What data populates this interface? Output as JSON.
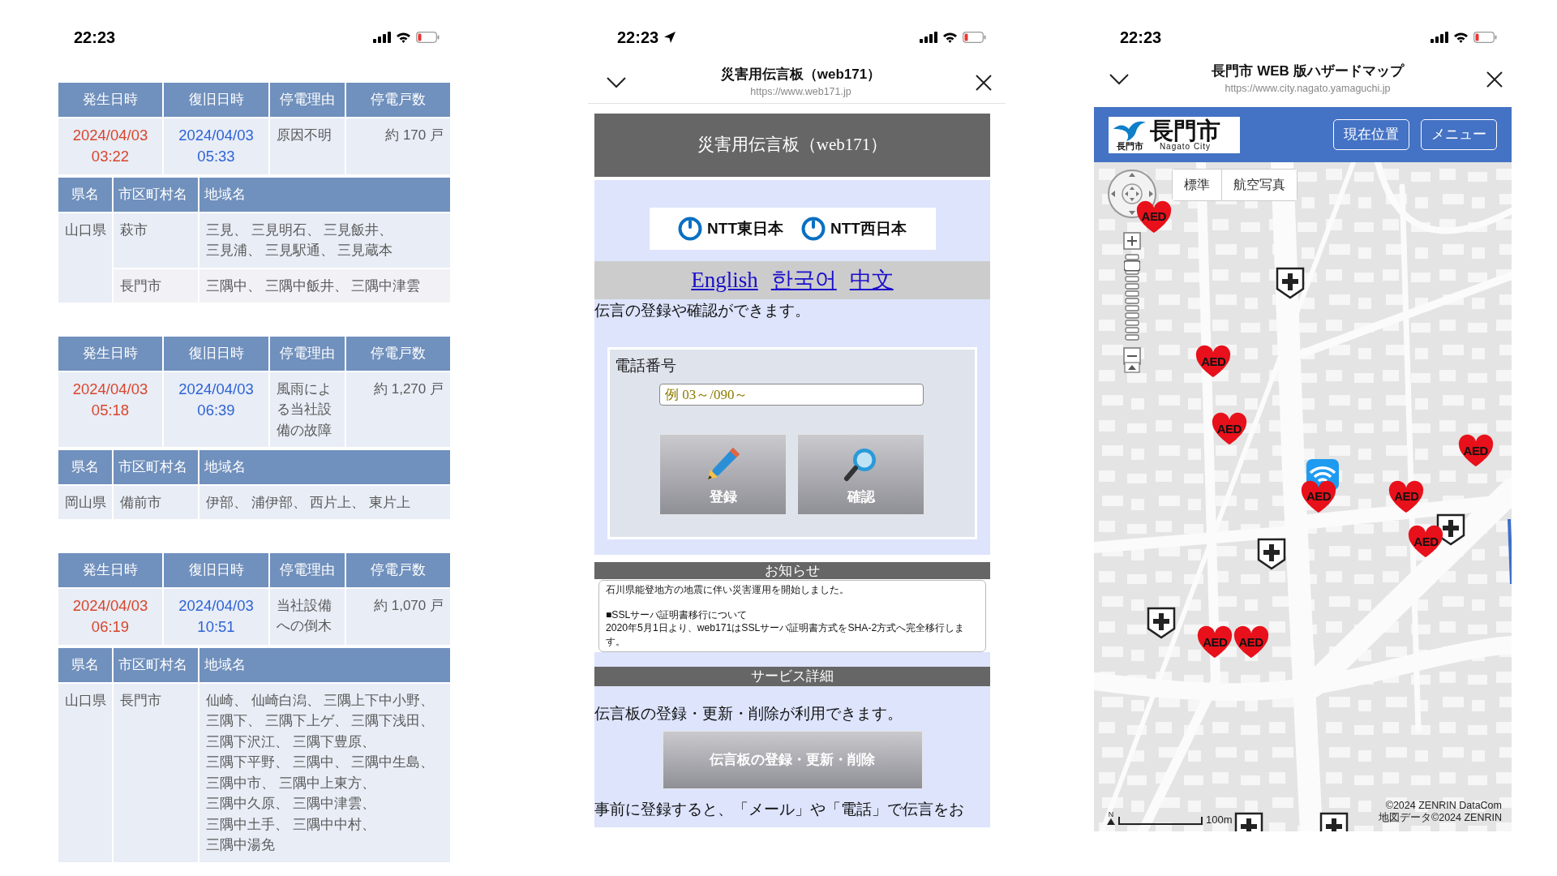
{
  "outage_screen": {
    "status_bar": {
      "time": "22:23",
      "location_active": false
    },
    "records": [
      {
        "columns": [
          "発生日時",
          "復旧日時",
          "停電理由",
          "停電戸数"
        ],
        "occurred": "2024/04/03 03:22",
        "restored": "2024/04/03 05:33",
        "reason": "原因不明",
        "households": "約 170 戸",
        "area_columns": [
          "県名",
          "市区町村名",
          "地域名"
        ],
        "prefectures": [
          {
            "name": "山口県",
            "cities": [
              {
                "name": "萩市",
                "areas": "三見、 三見明石、 三見飯井、三見浦、 三見駅通、 三見蔵本"
              },
              {
                "name": "長門市",
                "areas": "三隅中、 三隅中飯井、 三隅中津雲"
              }
            ]
          }
        ]
      },
      {
        "columns": [
          "発生日時",
          "復旧日時",
          "停電理由",
          "停電戸数"
        ],
        "occurred": "2024/04/03 05:18",
        "restored": "2024/04/03 06:39",
        "reason": "風雨による当社設備の故障",
        "households": "約 1,270 戸",
        "area_columns": [
          "県名",
          "市区町村名",
          "地域名"
        ],
        "prefectures": [
          {
            "name": "岡山県",
            "cities": [
              {
                "name": "備前市",
                "areas": "伊部、 浦伊部、 西片上、 東片上"
              }
            ]
          }
        ]
      },
      {
        "columns": [
          "発生日時",
          "復旧日時",
          "停電理由",
          "停電戸数"
        ],
        "occurred": "2024/04/03 06:19",
        "restored": "2024/04/03 10:51",
        "reason": "当社設備への倒木",
        "households": "約 1,070 戸",
        "area_columns": [
          "県名",
          "市区町村名",
          "地域名"
        ],
        "prefectures": [
          {
            "name": "山口県",
            "cities": [
              {
                "name": "長門市",
                "areas": "仙崎、 仙崎白潟、 三隅上下中小野、三隅下、 三隅下上ゲ、 三隅下浅田、三隅下沢江、 三隅下豊原、三隅下平野、 三隅中、 三隅中生島、三隅中市、 三隅中上東方、三隅中久原、 三隅中津雲、三隅中土手、 三隅中中村、三隅中湯免"
              }
            ]
          }
        ]
      }
    ]
  },
  "web171_screen": {
    "status_bar": {
      "time": "22:23",
      "location_active": true
    },
    "browser": {
      "title": "災害用伝言板（web171）",
      "url": "https://www.web171.jp"
    },
    "banner": "災害用伝言板（web171）",
    "logos": [
      "NTT東日本",
      "NTT西日本"
    ],
    "languages": [
      "English",
      "한국어",
      "中文"
    ],
    "intro": "伝言の登録や確認ができます。",
    "form": {
      "label": "電話番号",
      "placeholder": "例 03～/090～",
      "buttons": [
        {
          "kind": "register",
          "label": "登録"
        },
        {
          "kind": "confirm",
          "label": "確認"
        }
      ]
    },
    "notices_heading": "お知らせ",
    "notices": [
      {
        "lines": [
          "石川県能登地方の地震に伴い災害運用を開始しました。"
        ]
      },
      {
        "lines": [
          "■SSLサーバ証明書移行について",
          "2020年5月1日より、web171はSSLサーバ証明書方式をSHA-2方式へ完全移行します。"
        ]
      }
    ],
    "details_heading": "サービス詳細",
    "details_text": "伝言板の登録・更新・削除が利用できます。",
    "details_button": "伝言板の登録・更新・削除",
    "footer_text": "事前に登録すると、「メール」や「電話」で伝言をお"
  },
  "hazard_map_screen": {
    "status_bar": {
      "time": "22:23",
      "location_active": false
    },
    "browser": {
      "title": "長門市 WEB 版ハザードマップ",
      "url": "https://www.city.nagato.yamaguchi.jp"
    },
    "logo": {
      "name": "長門市",
      "small_name": "長門市",
      "english": "Nagato City"
    },
    "header_buttons": [
      "現在位置",
      "メニュー"
    ],
    "map_tabs": [
      "標準",
      "航空写真"
    ],
    "zoom_slider": {
      "level": 0.92
    },
    "markers": [
      {
        "kind": "cross"
      },
      {
        "kind": "cross"
      },
      {
        "kind": "cross"
      },
      {
        "kind": "cross"
      },
      {
        "kind": "cross"
      },
      {
        "kind": "cross"
      },
      {
        "kind": "wifi"
      },
      {
        "kind": "aed",
        "label": "AED"
      },
      {
        "kind": "aed",
        "label": "AED"
      },
      {
        "kind": "aed",
        "label": "AED"
      },
      {
        "kind": "aed",
        "label": "AED"
      },
      {
        "kind": "aed",
        "label": "AED"
      },
      {
        "kind": "aed",
        "label": "AED"
      },
      {
        "kind": "aed",
        "label": "AED"
      },
      {
        "kind": "aed",
        "label": "AED"
      },
      {
        "kind": "aed",
        "label": "AED"
      }
    ],
    "north_label": "N",
    "scale": "100m",
    "copyright": [
      "©2024 ZENRIN DataCom",
      "地図データ©2024 ZENRIN"
    ]
  }
}
